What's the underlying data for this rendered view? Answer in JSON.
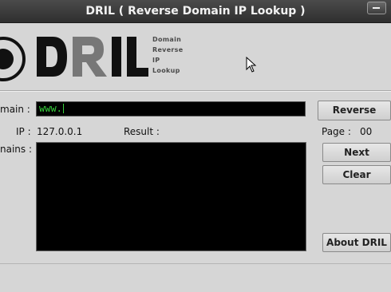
{
  "window": {
    "title": "DRIL ( Reverse Domain IP Lookup )"
  },
  "logo": {
    "wordmark": "DRIL",
    "subtitle_lines": [
      "Domain",
      "Reverse",
      "IP",
      "Lookup"
    ]
  },
  "form": {
    "domain_label": "main :",
    "domain_value": "www.",
    "ip_label": "IP :",
    "ip_value": "127.0.0.1",
    "result_label": "Result :",
    "domains_label": "nains :",
    "page_label": "Page :",
    "page_value": "00"
  },
  "buttons": {
    "reverse": "Reverse",
    "next": "Next",
    "clear": "Clear",
    "about": "About DRIL"
  },
  "colors": {
    "titlebar": "#3a3a3a",
    "background": "#d6d6d6",
    "input_bg": "#000000",
    "input_text": "#37d13b"
  }
}
